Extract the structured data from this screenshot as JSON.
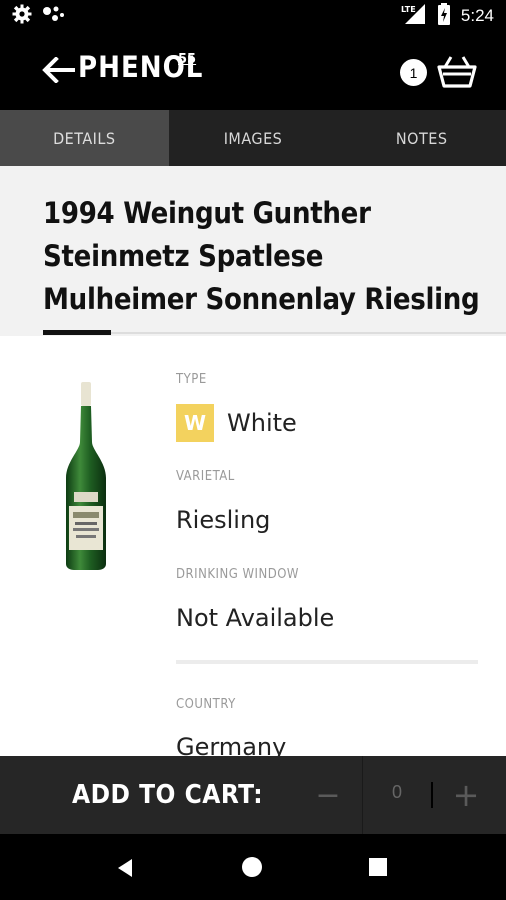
{
  "status_bar": {
    "time": "5:24",
    "network": "LTE",
    "icons": [
      "gear-icon",
      "dots-icon",
      "signal-icon",
      "battery-charging-icon"
    ]
  },
  "app_bar": {
    "brand": "PHENOL",
    "brand_sup": "55",
    "cart_count": "1",
    "icons": [
      "back-arrow-icon",
      "basket-icon"
    ]
  },
  "tabs": [
    {
      "label": "DETAILS",
      "active": true
    },
    {
      "label": "IMAGES",
      "active": false
    },
    {
      "label": "NOTES",
      "active": false
    }
  ],
  "wine": {
    "title": "1994 Weingut Gunther Steinmetz Spatlese Mulheimer Sonnenlay Riesling",
    "type_label": "TYPE",
    "type_badge": "W",
    "type_value": "White",
    "type_color": "#f3d25e",
    "varietal_label": "VARIETAL",
    "varietal_value": "Riesling",
    "drinking_window_label": "DRINKING WINDOW",
    "drinking_window_value": "Not Available",
    "country_label": "COUNTRY",
    "country_value": "Germany"
  },
  "cart_bar": {
    "label": "ADD TO CART:",
    "quantity": "0",
    "minus": "−",
    "plus": "+"
  }
}
